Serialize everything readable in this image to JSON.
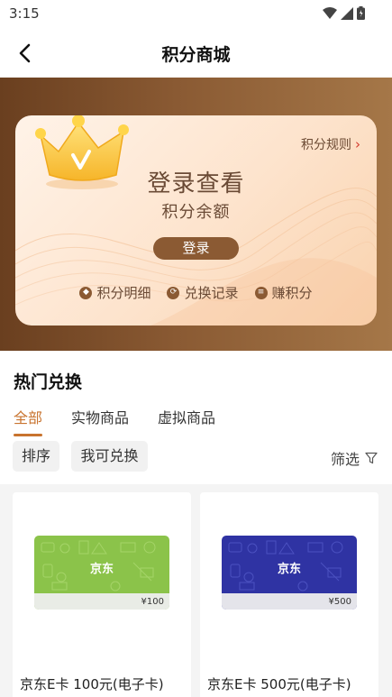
{
  "status_bar": {
    "time": "3:15",
    "icons": [
      "wifi-icon",
      "signal-icon",
      "battery-icon"
    ]
  },
  "header": {
    "title": "积分商城",
    "back_icon": "chevron-left-icon"
  },
  "hero": {
    "rules_link": "积分规则",
    "login_view": "登录查看",
    "balance_label": "积分余额",
    "login_button": "登录",
    "quick_links": [
      {
        "label": "积分明细",
        "icon": "points-detail-icon"
      },
      {
        "label": "兑换记录",
        "icon": "exchange-record-icon"
      },
      {
        "label": "赚积分",
        "icon": "earn-points-icon"
      }
    ],
    "colors": {
      "banner": "#8a5a33",
      "button": "#8b5a33",
      "text": "#6a4a35"
    }
  },
  "hot": {
    "title": "热门兑换",
    "tabs": [
      {
        "label": "全部",
        "active": true
      },
      {
        "label": "实物商品",
        "active": false
      },
      {
        "label": "虚拟商品",
        "active": false
      }
    ],
    "sort_label": "排序",
    "can_redeem_label": "我可兑换",
    "filter_label": "筛选",
    "accent": "#c8732e"
  },
  "products": [
    {
      "name": "京东E卡 100元(电子卡)",
      "brand": "京东",
      "card_price": "¥100",
      "card_color": "#8bc34a"
    },
    {
      "name": "京东E卡 500元(电子卡)",
      "brand": "京东",
      "card_price": "¥500",
      "card_color": "#2f33a3"
    }
  ]
}
